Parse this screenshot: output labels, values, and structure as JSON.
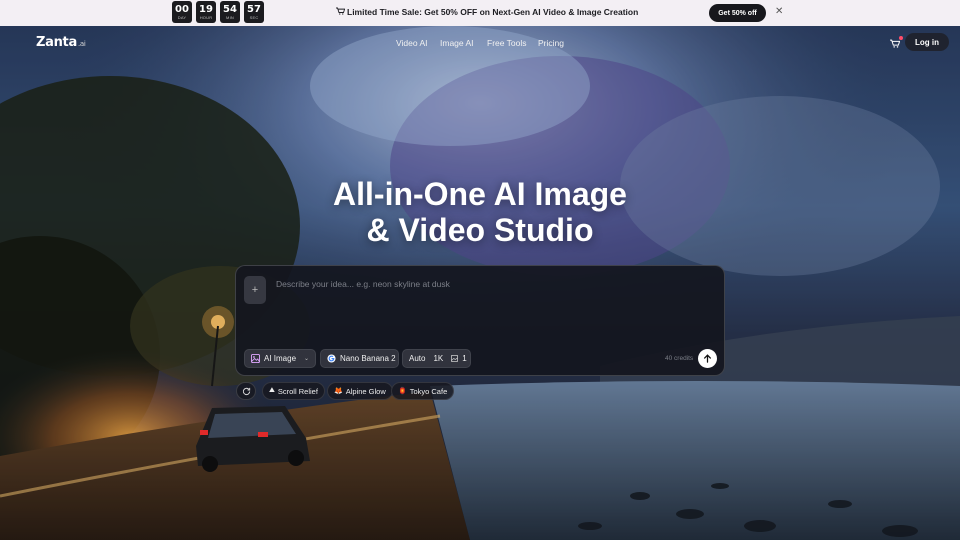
{
  "promo": {
    "countdown": [
      {
        "value": "00",
        "unit": "DAY"
      },
      {
        "value": "19",
        "unit": "HOUR"
      },
      {
        "value": "54",
        "unit": "MIN"
      },
      {
        "value": "57",
        "unit": "SEC"
      }
    ],
    "message": "Limited Time Sale: Get 50% OFF on Next-Gen AI Video & Image Creation",
    "cta_label": "Get 50% off",
    "close_icon": "close-icon"
  },
  "nav": {
    "logo_name": "Zanta",
    "logo_tld": ".ai",
    "links": [
      "Video AI",
      "Image AI",
      "Free Tools",
      "Pricing"
    ],
    "login_label": "Log in",
    "cart_icon": "cart-icon"
  },
  "hero": {
    "title_line1": "All-in-One AI Image",
    "title_line2": "& Video Studio"
  },
  "prompt": {
    "placeholder": "Describe your idea... e.g. neon skyline at dusk",
    "value": "",
    "mode_label": "AI Image",
    "model_label": "Nano Banana 2",
    "aspect_label": "Auto",
    "resolution_label": "1K",
    "count_label": "1",
    "credits_text": "40 credits"
  },
  "suggestions": [
    {
      "emoji": "⛰",
      "label": "Scroll Relief"
    },
    {
      "emoji": "🦊",
      "label": "Alpine Glow"
    },
    {
      "emoji": "🏮",
      "label": "Tokyo Cafe"
    }
  ],
  "colors": {
    "promo_bg": "#f3eff4",
    "promo_cta_bg": "#17171c",
    "panel_bg": "#14161e",
    "accent_red": "#ff4d6a"
  }
}
